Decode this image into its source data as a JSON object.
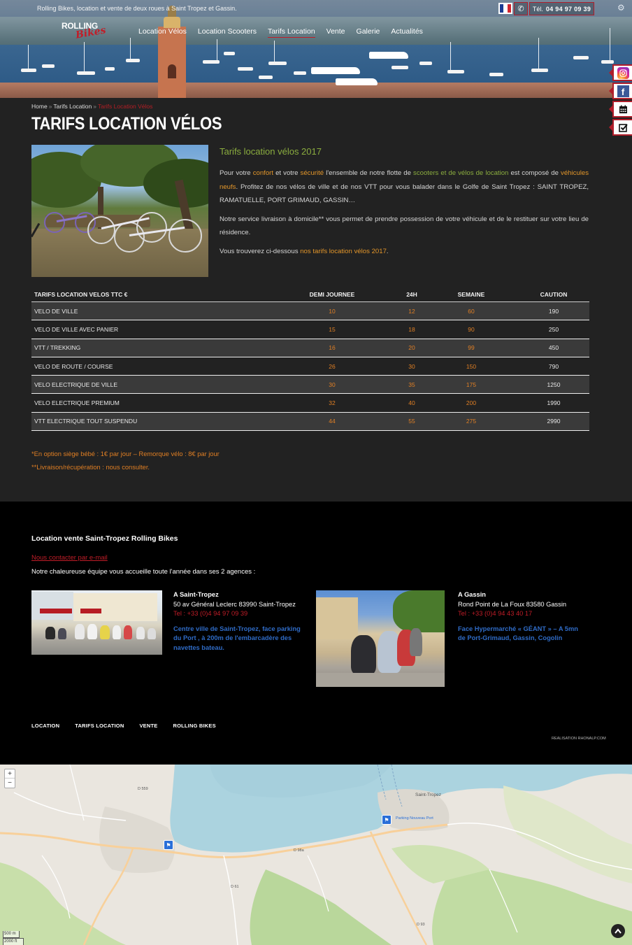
{
  "header": {
    "tagline": "Rolling Bikes, location et vente de deux roues à Saint Tropez et Gassin.",
    "phone_prefix": "Tél.",
    "phone_number": "04 94 97 09 39",
    "logo_line1": "ROLLING",
    "logo_line2": "Bikes",
    "nav": [
      {
        "label": "Location Vélos"
      },
      {
        "label": "Location Scooters"
      },
      {
        "label": "Tarifs Location"
      },
      {
        "label": "Vente"
      },
      {
        "label": "Galerie"
      },
      {
        "label": "Actualités"
      }
    ],
    "flag_colors": [
      "#1a3b93",
      "#ffffff",
      "#d22630"
    ],
    "side_icons": [
      "instagram-icon",
      "facebook-icon",
      "calendar-icon",
      "checkbox-icon"
    ]
  },
  "breadcrumb": {
    "home": "Home",
    "parent": "Tarifs Location",
    "current": "Tarifs Location Vélos"
  },
  "page": {
    "title": "TARIFS LOCATION VÉLOS",
    "subtitle": "Tarifs location vélos 2017",
    "p1": {
      "a": "Pour votre ",
      "b": "confort",
      "c": " et votre ",
      "d": "sécurité",
      "e": " l'ensemble de notre flotte de ",
      "f": "scooters et de vélos de location",
      "g": " est composé de ",
      "h": "véhicules neufs",
      "i": ". Profitez de nos vélos de ville et de nos VTT pour vous balader dans le Golfe de Saint Tropez : SAINT TROPEZ, RAMATUELLE, PORT GRIMAUD, GASSIN…"
    },
    "p2": "Notre service livraison à domicile** vous permet de prendre possession de votre véhicule et de le restituer sur votre lieu de résidence.",
    "p3": {
      "a": "Vous trouverez ci-dessous ",
      "b": "nos tarifs location vélos 2017",
      "c": "."
    }
  },
  "table": {
    "headers": [
      "TARIFS LOCATION VELOS TTC €",
      "DEMI JOURNEE",
      "24H",
      "SEMAINE",
      "CAUTION"
    ],
    "rows": [
      [
        "VELO DE VILLE",
        "10",
        "12",
        "60",
        "190"
      ],
      [
        "VELO DE VILLE AVEC PANIER",
        "15",
        "18",
        "90",
        "250"
      ],
      [
        "VTT / TREKKING",
        "16",
        "20",
        "99",
        "450"
      ],
      [
        "VELO DE ROUTE / COURSE",
        "26",
        "30",
        "150",
        "790"
      ],
      [
        "VELO ELECTRIQUE DE VILLE",
        "30",
        "35",
        "175",
        "1250"
      ],
      [
        "VELO ELECTRIQUE PREMIUM",
        "32",
        "40",
        "200",
        "1990"
      ],
      [
        "VTT ELECTRIQUE TOUT SUSPENDU",
        "44",
        "55",
        "275",
        "2990"
      ]
    ]
  },
  "notes": {
    "n1": "*En option siège bébé : 1€ par jour – Remorque vélo : 8€ par jour",
    "n2": "**Livraison/récupération : nous consulter."
  },
  "footer": {
    "heading": "Location vente Saint-Tropez Rolling Bikes",
    "contact_link": "Nous contacter par e-mail",
    "welcome": "Notre chaleureuse équipe vous accueille toute l'année dans ses 2 agences :",
    "agencies": [
      {
        "name": "A Saint-Tropez",
        "address": "50 av Général Leclerc 83990 Saint-Tropez",
        "tel": "Tel : +33 (0)4 94 97 09 39",
        "desc": "Centre ville de Saint-Tropez, face parking du Port , à 200m de l'embarcadère des navettes bateau."
      },
      {
        "name": "A Gassin",
        "address": "Rond Point de La Foux 83580 Gassin",
        "tel": "Tel : +33 (0)4 94 43 40 17",
        "desc": "Face Hypermarché « GÉANT » – A 5mn de Port-Grimaud, Gassin, Cogolin"
      }
    ],
    "nav": [
      "LOCATION",
      "TARIFS LOCATION",
      "VENTE",
      "ROLLING BIKES"
    ],
    "credit": "REALISATION RHONALP.COM"
  },
  "map": {
    "zoom_in": "+",
    "zoom_out": "−",
    "scale_m": "500 m",
    "scale_ft": "2000 ft",
    "labels": [
      "Saint-Tropez",
      "Parking Nouveau Port",
      "D 559",
      "D 98a",
      "D 61",
      "D 93"
    ]
  }
}
